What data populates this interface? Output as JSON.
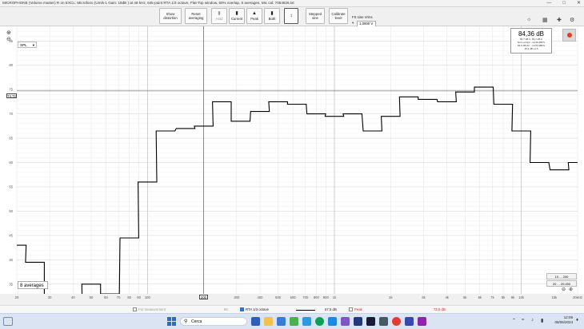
{
  "window": {
    "title": "MICROPHONE (Volume master) R on EXCL: Microfono (Umik-1 Gain: 18dB ) at 48 kHz, 64k-point RTA 1/3 octave, Flat-Top window, 50% overlap, 8 averages, Mic cal: 7054826.txt"
  },
  "toolbar": {
    "show_distortion": "Show distortion",
    "reset_averaging": "Reset averaging",
    "hold": "Hold",
    "current": "Current",
    "peak": "Peak",
    "both": "Both",
    "stepped_sine": "Stepped sine",
    "calibrate_level": "Calibrate level",
    "fs_sine_vrms": "FS sine Vrms",
    "fs_value": "1,0000 V"
  },
  "readout": {
    "big": "84,36 dB",
    "lines": [
      "83,7 dB C, 83,7 dB A",
      "Num arrays: -12,00 dBFS",
      "84,6 dB Z2 : -12,00 dBFS",
      "45,4 dB +2,5"
    ]
  },
  "graph": {
    "spl_select": "SPL",
    "averages": "8 averages",
    "cursor_value": "74,72",
    "cursor_freq": "200",
    "range_top": "10 ... 200",
    "range_bottom": "20 ... 20.000"
  },
  "legend": {
    "for_measurement": "For measurement",
    "for_measurement_val": "80",
    "rta": "RTA 1/3 octave",
    "rta_val": "67,5 dB",
    "peak": "Peak",
    "peak_val": "72,5 dB"
  },
  "taskbar": {
    "search": "Cerca",
    "time": "12:09",
    "date": "08/06/2024"
  },
  "chart_data": {
    "type": "line",
    "title": "",
    "xlabel": "",
    "ylabel": "",
    "x_scale": "log",
    "xlim": [
      20,
      20000
    ],
    "ylim": [
      33,
      88
    ],
    "grid": true,
    "y_ticks": [
      {
        "v": 85,
        "l": "85"
      },
      {
        "v": 80,
        "l": "80"
      },
      {
        "v": 75,
        "l": "75"
      },
      {
        "v": 70,
        "l": "70"
      },
      {
        "v": 65,
        "l": "65"
      },
      {
        "v": 60,
        "l": "60"
      },
      {
        "v": 55,
        "l": "55"
      },
      {
        "v": 50,
        "l": "50"
      },
      {
        "v": 45,
        "l": "45"
      },
      {
        "v": 40,
        "l": "40"
      },
      {
        "v": 35,
        "l": "35"
      }
    ],
    "x_ticks": [
      {
        "v": 20,
        "l": "20"
      },
      {
        "v": 30,
        "l": "30"
      },
      {
        "v": 40,
        "l": "40"
      },
      {
        "v": 50,
        "l": "50"
      },
      {
        "v": 60,
        "l": "60"
      },
      {
        "v": 70,
        "l": "70"
      },
      {
        "v": 80,
        "l": "80"
      },
      {
        "v": 90,
        "l": "90"
      },
      {
        "v": 100,
        "l": "100"
      },
      {
        "v": 300,
        "l": "300"
      },
      {
        "v": 400,
        "l": "400"
      },
      {
        "v": 500,
        "l": "500"
      },
      {
        "v": 600,
        "l": "600"
      },
      {
        "v": 700,
        "l": "700"
      },
      {
        "v": 800,
        "l": "800"
      },
      {
        "v": 900,
        "l": "900"
      },
      {
        "v": 1000,
        "l": "1k"
      },
      {
        "v": 2000,
        "l": "2k"
      },
      {
        "v": 3000,
        "l": "3k"
      },
      {
        "v": 4000,
        "l": "4k"
      },
      {
        "v": 5000,
        "l": "5k"
      },
      {
        "v": 6000,
        "l": "6k"
      },
      {
        "v": 7000,
        "l": "7k"
      },
      {
        "v": 8000,
        "l": "8k"
      },
      {
        "v": 9000,
        "l": "9k"
      },
      {
        "v": 10000,
        "l": "10k"
      },
      {
        "v": 15000,
        "l": "15k"
      },
      {
        "v": 20000,
        "l": "20kHz"
      }
    ],
    "cursor": {
      "x": 200,
      "y": 74.72
    },
    "series": [
      {
        "name": "RTA 1/3 octave",
        "color": "#000000",
        "bands": [
          {
            "f": 20,
            "v": 43
          },
          {
            "f": 25,
            "v": 39.5
          },
          {
            "f": 31.5,
            "v": 28
          },
          {
            "f": 40,
            "v": 28
          },
          {
            "f": 50,
            "v": 35
          },
          {
            "f": 63,
            "v": 33
          },
          {
            "f": 80,
            "v": 44.5
          },
          {
            "f": 100,
            "v": 56
          },
          {
            "f": 125,
            "v": 66.5
          },
          {
            "f": 160,
            "v": 67
          },
          {
            "f": 200,
            "v": 67.5
          },
          {
            "f": 250,
            "v": 72.5
          },
          {
            "f": 315,
            "v": 68.5
          },
          {
            "f": 400,
            "v": 70.5
          },
          {
            "f": 500,
            "v": 72.5
          },
          {
            "f": 630,
            "v": 72
          },
          {
            "f": 800,
            "v": 70
          },
          {
            "f": 1000,
            "v": 69.5
          },
          {
            "f": 1250,
            "v": 70
          },
          {
            "f": 1600,
            "v": 66.5
          },
          {
            "f": 2000,
            "v": 69.5
          },
          {
            "f": 2500,
            "v": 73.5
          },
          {
            "f": 3150,
            "v": 73
          },
          {
            "f": 4000,
            "v": 72.5
          },
          {
            "f": 5000,
            "v": 74.5
          },
          {
            "f": 6300,
            "v": 75.5
          },
          {
            "f": 8000,
            "v": 72
          },
          {
            "f": 10000,
            "v": 66.5
          },
          {
            "f": 12500,
            "v": 60
          },
          {
            "f": 16000,
            "v": 58.5
          },
          {
            "f": 20000,
            "v": 60
          }
        ]
      }
    ]
  }
}
